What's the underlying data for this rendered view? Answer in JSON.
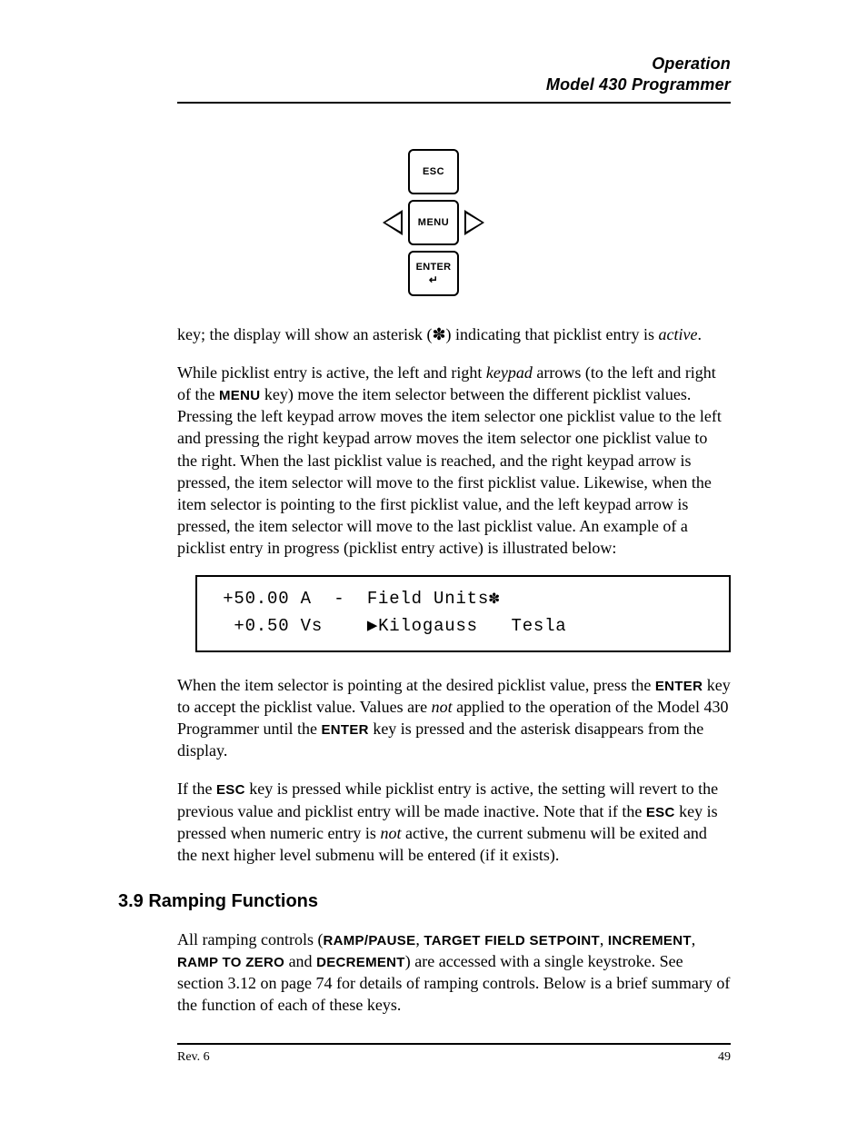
{
  "header": {
    "line1": "Operation",
    "line2": "Model 430 Programmer"
  },
  "keypad": {
    "esc": "ESC",
    "menu": "MENU",
    "enter": "ENTER",
    "enter_arrow": "↵"
  },
  "para1": {
    "t1": "key; the display will show an asterisk (",
    "asterisk": "✽",
    "t2": ") indicating that picklist entry is ",
    "active": "active",
    "t3": "."
  },
  "para2": {
    "t1": "While picklist entry is active, the left and right ",
    "keypad": "keypad",
    "t2": " arrows (to the left and right of the ",
    "menu": "MENU",
    "t3": " key) move the item selector between the different picklist values. Pressing the left keypad arrow moves the item selector one picklist value to the left and pressing the right keypad arrow moves the item selector one picklist value to the right. When the last picklist value is reached, and the right keypad arrow is pressed, the item selector will move to the first picklist value. Likewise, when the item selector is pointing to the first picklist value, and the left keypad arrow is pressed, the item selector will move to the last picklist value. An example of a picklist entry in progress (picklist entry active) is illustrated below:"
  },
  "display": {
    "line1": " +50.00 A  -  Field Units✽",
    "line2": "  +0.50 Vs    ▶Kilogauss   Tesla"
  },
  "para3": {
    "t1": "When the item selector is pointing at the desired picklist value, press the ",
    "enter1": "ENTER",
    "t2": " key to accept the picklist value. Values are ",
    "not1": "not",
    "t3": " applied to the operation of the Model 430 Programmer until the ",
    "enter2": "ENTER",
    "t4": " key is pressed and the asterisk disappears from the display."
  },
  "para4": {
    "t1": "If the ",
    "esc1": "ESC",
    "t2": " key is pressed while picklist entry is active, the setting will revert to the previous value and picklist entry will be made inactive. Note that if the ",
    "esc2": "ESC",
    "t3": " key is pressed when numeric entry is ",
    "not2": "not",
    "t4": " active, the current submenu will be exited and the next higher level submenu will be entered (if it exists)."
  },
  "section": "3.9 Ramping Functions",
  "para5": {
    "t1": "All ramping controls (",
    "ramp_pause": "RAMP/PAUSE",
    "c1": ", ",
    "target": "TARGET FIELD SETPOINT",
    "c2": ", ",
    "inc": "INCREMENT",
    "c3": ", ",
    "ramp_zero": "RAMP TO ZERO",
    "c4": " and ",
    "decrement": "DECREMENT",
    "t2": ") are accessed with a single keystroke. See section 3.12 on page 74 for details of ramping controls. Below is a brief summary of the function of each of these keys."
  },
  "footer": {
    "rev": "Rev. 6",
    "page": "49"
  }
}
